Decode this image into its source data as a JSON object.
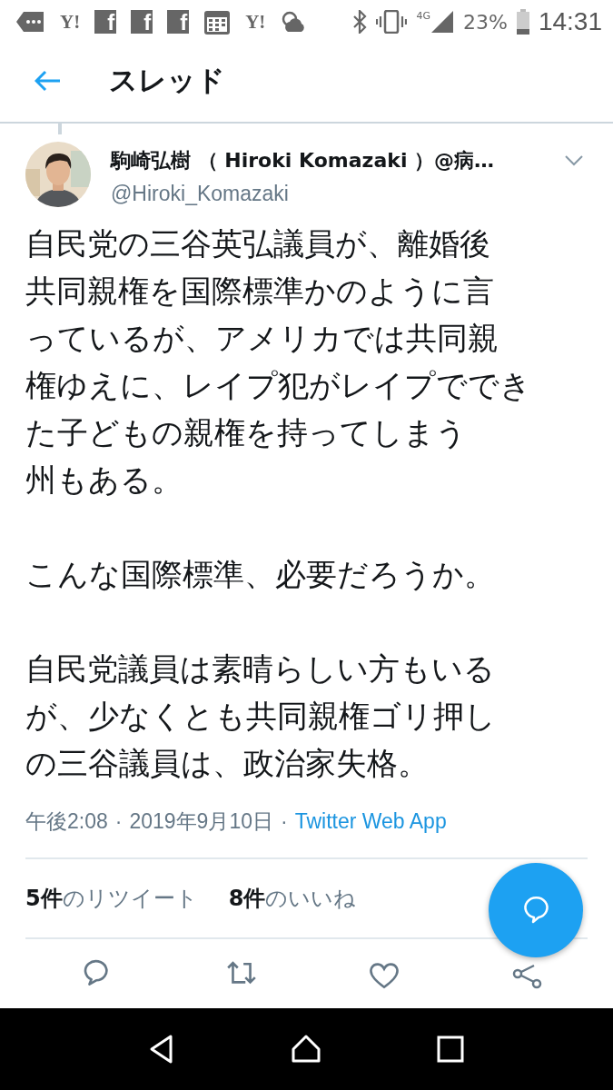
{
  "status_bar": {
    "notifications": [
      {
        "kind": "tag"
      },
      {
        "kind": "text",
        "text": "Y!"
      },
      {
        "kind": "fb",
        "text": "f"
      },
      {
        "kind": "fb",
        "text": "f"
      },
      {
        "kind": "fb",
        "text": "f"
      },
      {
        "kind": "calendar"
      },
      {
        "kind": "text",
        "text": "Y!"
      },
      {
        "kind": "weather"
      }
    ],
    "network": "4G",
    "battery": "23%",
    "time": "14:31"
  },
  "header": {
    "title": "スレッド"
  },
  "tweet": {
    "author": {
      "name": "駒崎弘樹 （ Hiroki Komazaki ）@病…",
      "handle": "@Hiroki_Komazaki"
    },
    "paragraphs": [
      {
        "lines": [
          "自民党の三谷英弘議員が、離婚後",
          "共同親権を国際標準かのように言",
          "っているが、アメリカでは共同親",
          "権ゆえに、レイプ犯がレイプででき",
          "た子どもの親権を持ってしまう",
          "州もある。"
        ]
      },
      {
        "lines": [
          "こんな国際標準、必要だろうか。"
        ]
      },
      {
        "lines": [
          "自民党議員は素晴らしい方もいる",
          "が、少なくとも共同親権ゴリ押し",
          "の三谷議員は、政治家失格。"
        ]
      }
    ],
    "meta": [
      {
        "kind": "time",
        "text": "午後2:08"
      },
      {
        "kind": "separator",
        "text": "·"
      },
      {
        "kind": "date",
        "text": "2019年9月10日"
      },
      {
        "kind": "separator",
        "text": "·"
      },
      {
        "kind": "source",
        "text": "Twitter Web App"
      }
    ],
    "stats": [
      {
        "count": "5件",
        "label": "のリツイート"
      },
      {
        "count": "8件",
        "label": "のいいね"
      }
    ],
    "actions": [
      {
        "kind": "reply"
      },
      {
        "kind": "retweet"
      },
      {
        "kind": "like"
      },
      {
        "kind": "share"
      }
    ]
  },
  "nav": [
    {
      "kind": "back"
    },
    {
      "kind": "home"
    },
    {
      "kind": "recents"
    }
  ]
}
